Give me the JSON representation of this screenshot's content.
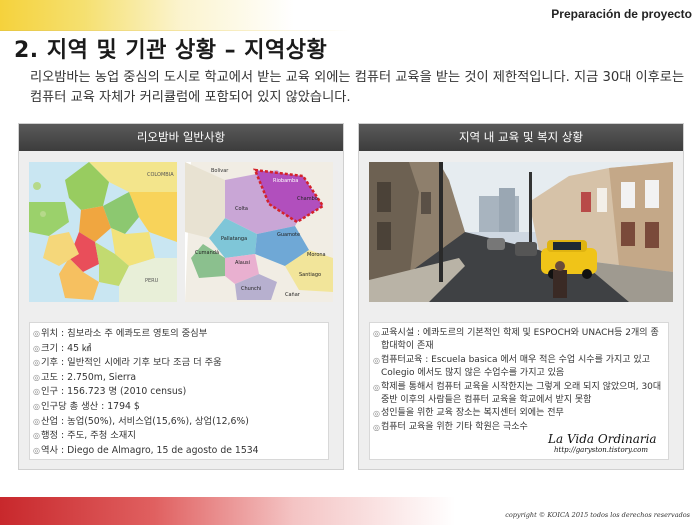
{
  "header": {
    "project_label": "Preparación de proyecto"
  },
  "title": "2. 지역 및 기관 상황 – 지역상황",
  "intro": "리오밤바는 농업 중심의 도시로 학교에서 받는 교육 외에는 컴퓨터 교육을 받는 것이 제한적입니다. 지금 30대 이후로는 컴퓨터 교육 자체가 커리큘럼에 포함되어 있지 않았습니다.",
  "left_panel": {
    "heading": "리오밤바 일반사항",
    "map1_labels": [
      "COLOMBIA",
      "PERU"
    ],
    "map2_labels": [
      "Bolivar",
      "Riobamba",
      "Chambo",
      "Colta",
      "Guamote",
      "Pallatanga",
      "Alausi",
      "Cumandá",
      "Chunchi",
      "Morona",
      "Cañar",
      "Santiago"
    ],
    "items": [
      "위치 : 침보라소 주 에콰도르 영토의 중심부",
      "크기 : 45 ㎢",
      "기후 : 일반적인 시에라 기후 보다 조금 더 주움",
      "고도 : 2.750m, Sierra",
      "인구 : 156.723 명 (2010 census)",
      "인구당 총 생산 : 1794 $",
      "산업 : 농업(50%), 서비스업(15,6%), 상업(12,6%)",
      "행정 : 주도, 주청 소재지",
      "역사 : Diego de Almagro,  15 de agosto  de 1534"
    ]
  },
  "right_panel": {
    "heading": "지역 내 교육 및 복지 상황",
    "items": [
      "교육시설 : 에콰도르의 기본적인 학제 및 ESPOCH와 UNACH등 2개의 종합대학이 존재",
      "컴퓨터교육 : Escuela basica 에서 매우 적은 수업 시수를 가지고 있고 Colegio 에서도 많지 않은 수업수를 가지고 있음",
      "학제를 통해서 컴퓨터 교육을 시작한지는 그렇게 오래 되지 않았으며, 30대 중반 이후의 사람들은 컴퓨터 교육을 학교에서 받지 못함",
      "성인들을 위한 교육 장소는 복지센터 외에는 전무",
      "컴퓨터 교육을 위한 기타 학원은 극소수"
    ]
  },
  "watermark": {
    "line1": "La Vida Ordinaria",
    "line2": "http://garyston.tistory.com"
  },
  "footer": {
    "copyright": "copyright  ©  KOICA  2015  todos  los  derechos  reservados"
  }
}
